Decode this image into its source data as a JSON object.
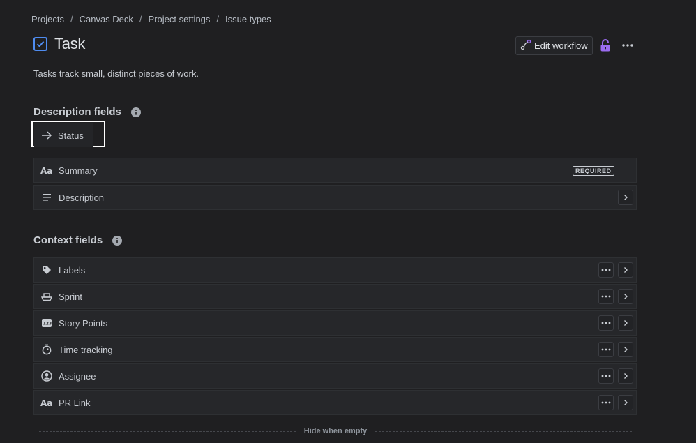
{
  "breadcrumb": [
    {
      "label": "Projects"
    },
    {
      "label": "Canvas Deck"
    },
    {
      "label": "Project settings"
    },
    {
      "label": "Issue types"
    }
  ],
  "breadcrumb_separator": "/",
  "header": {
    "title": "Task",
    "icon": "checkbox-icon",
    "edit_workflow_label": "Edit workflow"
  },
  "description": "Tasks track small, distinct pieces of work.",
  "description_fields": {
    "title": "Description fields",
    "status_label": "Status",
    "rows": [
      {
        "label": "Summary",
        "icon": "text-icon",
        "badge": "REQUIRED"
      },
      {
        "label": "Description",
        "icon": "lines-icon"
      }
    ]
  },
  "context_fields": {
    "title": "Context fields",
    "rows": [
      {
        "label": "Labels",
        "icon": "tag-icon"
      },
      {
        "label": "Sprint",
        "icon": "boat-icon"
      },
      {
        "label": "Story Points",
        "icon": "number-icon"
      },
      {
        "label": "Time tracking",
        "icon": "stopwatch-icon"
      },
      {
        "label": "Assignee",
        "icon": "person-icon"
      },
      {
        "label": "PR Link",
        "icon": "text-icon"
      }
    ]
  },
  "hide_when_empty_label": "Hide when empty",
  "colors": {
    "background": "#1f1f21",
    "accent_blue": "#4f8cf0",
    "lock_purple": "#9b6cf0"
  }
}
